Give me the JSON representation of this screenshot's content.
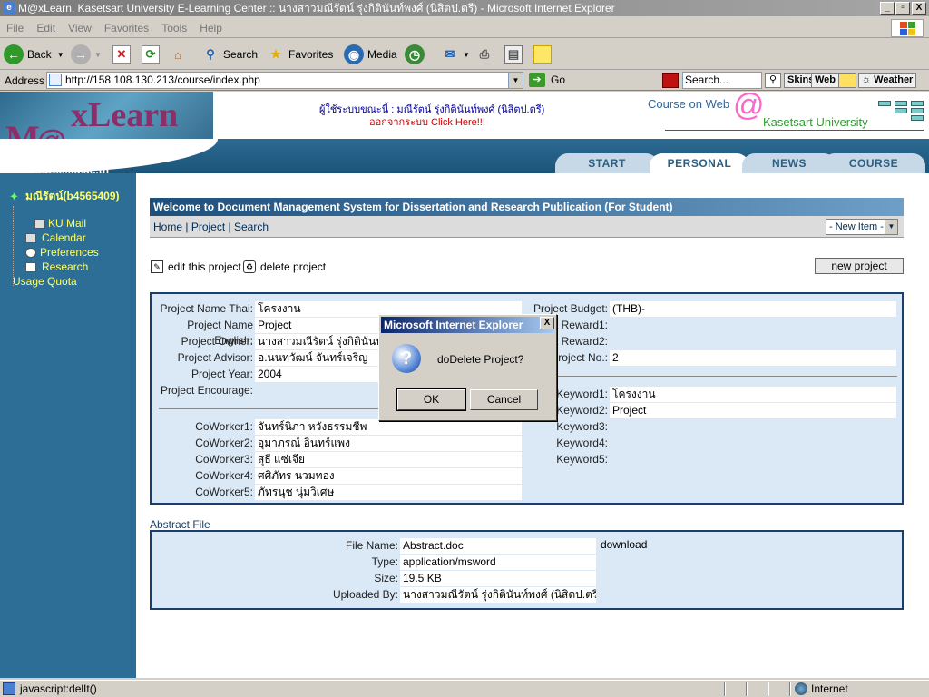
{
  "window": {
    "title": "M@xLearn, Kasetsart University E-Learning Center :: นางสาวมณีรัตน์ รุ่งกิตินันท์พงศ์ (นิสิตป.ตรี) - Microsoft Internet Explorer",
    "min": "_",
    "max": "▫",
    "close": "X"
  },
  "menu": [
    "File",
    "Edit",
    "View",
    "Favorites",
    "Tools",
    "Help"
  ],
  "toolbar": {
    "back": "Back",
    "search": "Search",
    "favorites": "Favorites",
    "media": "Media"
  },
  "address": {
    "label": "Address",
    "url": "http://158.108.130.213/course/index.php",
    "go": "Go",
    "search_placeholder": "Search...",
    "skins": "Skins",
    "web": "Web",
    "weather": "Weather"
  },
  "header": {
    "logo_m": "M",
    "logo_at": "@",
    "logo_x": "xLearn",
    "domain": "course.ku.ac.th",
    "user_line": "ผู้ใช้ระบบขณะนี้ : มณีรัตน์ รุ่งกิตินันท์พงศ์ (นิสิตป.ตรี)",
    "logout_prefix": "ออกจากระบบ",
    "logout_link": "Click Here!!!",
    "cow_title": "Course on Web",
    "cow_at": "@",
    "cow_sub": "Kasetsart University"
  },
  "tabs": [
    {
      "label": "START",
      "active": false
    },
    {
      "label": "PERSONAL",
      "active": true
    },
    {
      "label": "NEWS",
      "active": false
    },
    {
      "label": "COURSE",
      "active": false
    }
  ],
  "sidebar": {
    "user": "มณีรัตน์(b4565409)",
    "items": [
      "KU Mail",
      "Calendar",
      "Preferences",
      "Research",
      "Usage Quota"
    ]
  },
  "main": {
    "welcome": "Welcome to Document Management System for Dissertation and Research Publication (For Student)",
    "nav": {
      "home": "Home",
      "project": "Project",
      "search": "Search",
      "sep": "|"
    },
    "new_item": "- New Item -",
    "edit": "edit this project",
    "delete": "delete project",
    "new_project": "new project"
  },
  "project": {
    "left": [
      {
        "label": "Project Name Thai:",
        "value": "โครงงาน"
      },
      {
        "label": "Project Name English:",
        "value": "Project"
      },
      {
        "label": "Project Owner:",
        "value": "นางสาวมณีรัตน์ รุ่งกิตินันท์พงศ์"
      },
      {
        "label": "Project Advisor:",
        "value": "อ.นนทวัฒน์ จันทร์เจริญ"
      },
      {
        "label": "Project Year:",
        "value": "2004"
      },
      {
        "label": "Project Encourage:",
        "value": ""
      }
    ],
    "right": [
      {
        "label": "Project Budget:",
        "value": "(THB)-"
      },
      {
        "label": "ct Reward1:",
        "value": ""
      },
      {
        "label": "ct Reward2:",
        "value": ""
      },
      {
        "label": "Project No.:",
        "value": "2"
      }
    ],
    "coworkers": [
      {
        "label": "CoWorker1:",
        "value": "จันทร์นิภา หวังธรรมชีพ"
      },
      {
        "label": "CoWorker2:",
        "value": "อุมาภรณ์ อินทร์แพง"
      },
      {
        "label": "CoWorker3:",
        "value": "สุธี แซ่เจีย"
      },
      {
        "label": "CoWorker4:",
        "value": "ศศิภัทร นวมทอง"
      },
      {
        "label": "CoWorker5:",
        "value": "ภัทรนุช นุ่มวิเศษ"
      }
    ],
    "keywords": [
      {
        "label": "Keyword1:",
        "value": "โครงงาน"
      },
      {
        "label": "Keyword2:",
        "value": "Project"
      },
      {
        "label": "Keyword3:",
        "value": ""
      },
      {
        "label": "Keyword4:",
        "value": ""
      },
      {
        "label": "Keyword5:",
        "value": ""
      }
    ]
  },
  "abstract": {
    "title": "Abstract File",
    "rows": [
      {
        "label": "File Name:",
        "value": "Abstract.doc"
      },
      {
        "label": "Type:",
        "value": "application/msword"
      },
      {
        "label": "Size:",
        "value": "19.5 KB"
      },
      {
        "label": "Uploaded By:",
        "value": "นางสาวมณีรัตน์ รุ่งกิตินันท์พงศ์ (นิสิตป.ตรี)"
      }
    ],
    "download": "download"
  },
  "dialog": {
    "title": "Microsoft Internet Explorer",
    "close": "X",
    "icon": "?",
    "message": "doDelete Project?",
    "ok": "OK",
    "cancel": "Cancel"
  },
  "status": {
    "text": "javascript:delIt()",
    "zone": "Internet"
  }
}
